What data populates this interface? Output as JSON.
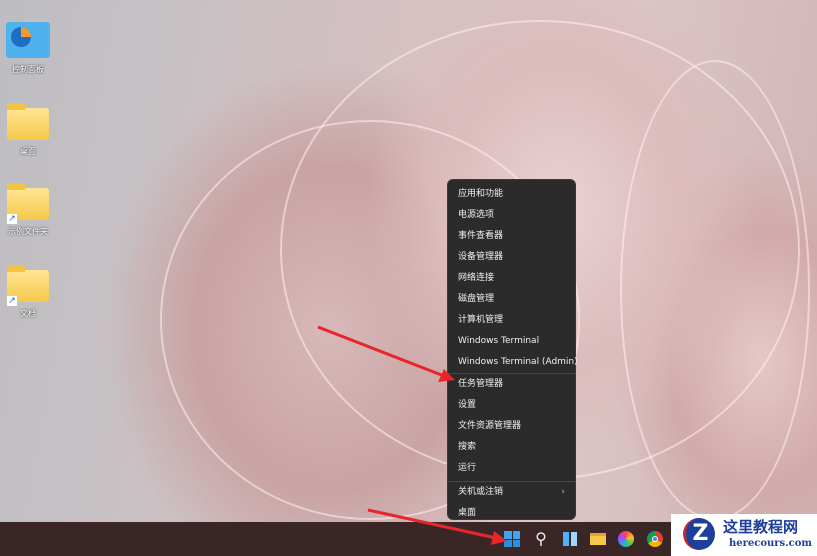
{
  "desktop": {
    "icons": [
      {
        "label": "控制面板",
        "type": "control-panel"
      },
      {
        "label": "桌面",
        "type": "folder"
      },
      {
        "label": "示例文件夹",
        "type": "folder-shortcut"
      },
      {
        "label": "文档",
        "type": "folder-shortcut"
      }
    ]
  },
  "context_menu": {
    "items": [
      "应用和功能",
      "电源选项",
      "事件查看器",
      "设备管理器",
      "网络连接",
      "磁盘管理",
      "计算机管理",
      "Windows Terminal",
      "Windows Terminal (Admin)",
      "任务管理器",
      "设置",
      "文件资源管理器",
      "搜索",
      "运行",
      "关机或注销",
      "桌面"
    ]
  },
  "taskbar": {
    "icons": [
      "start-icon",
      "search-icon",
      "widgets-icon",
      "file-explorer-icon",
      "photos-icon",
      "chrome-icon"
    ]
  },
  "watermark": {
    "title": "这里教程网",
    "url": "herecours.com"
  },
  "colors": {
    "arrow": "#e8262a",
    "menu_bg": "#2b2b2b",
    "taskbar_bg": "#3a2627"
  }
}
